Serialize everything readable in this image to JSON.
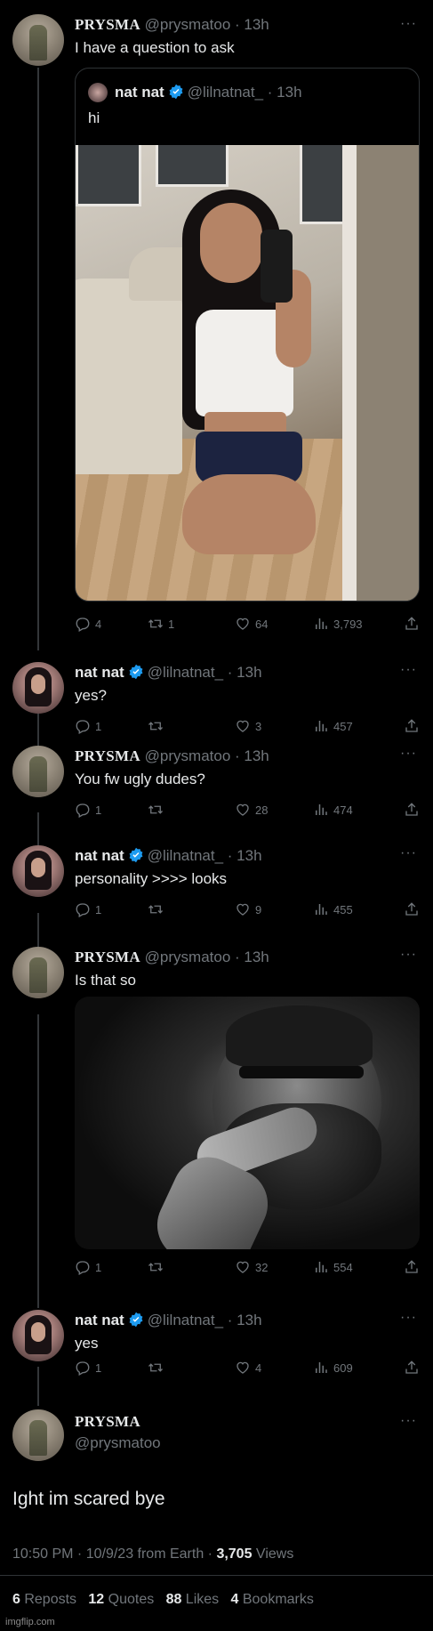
{
  "tweets": [
    {
      "name": "PRYSMA",
      "handle": "@prysmatoo",
      "time": "13h",
      "text": "I have a question to ask",
      "quote": {
        "name": "nat nat",
        "handle": "@lilnatnat_",
        "time": "13h",
        "text": "hi"
      },
      "replies": "4",
      "reposts": "1",
      "likes": "64",
      "views": "3,793"
    },
    {
      "name": "nat nat",
      "handle": "@lilnatnat_",
      "time": "13h",
      "text": "yes?",
      "replies": "1",
      "reposts": "",
      "likes": "3",
      "views": "457"
    },
    {
      "name": "PRYSMA",
      "handle": "@prysmatoo",
      "time": "13h",
      "text": "You fw ugly dudes?",
      "replies": "1",
      "reposts": "",
      "likes": "28",
      "views": "474"
    },
    {
      "name": "nat nat",
      "handle": "@lilnatnat_",
      "time": "13h",
      "text": "personality >>>> looks",
      "replies": "1",
      "reposts": "",
      "likes": "9",
      "views": "455"
    },
    {
      "name": "PRYSMA",
      "handle": "@prysmatoo",
      "time": "13h",
      "text": "Is that so",
      "replies": "1",
      "reposts": "",
      "likes": "32",
      "views": "554"
    },
    {
      "name": "nat nat",
      "handle": "@lilnatnat_",
      "time": "13h",
      "text": "yes",
      "replies": "1",
      "reposts": "",
      "likes": "4",
      "views": "609"
    }
  ],
  "main": {
    "name": "PRYSMA",
    "handle": "@prysmatoo",
    "text": "Ight im scared bye",
    "meta_time": "10:50 PM · 10/9/23 from Earth · ",
    "views_count": "3,705",
    "views_label": " Views",
    "reposts_count": "6",
    "reposts_label": " Reposts",
    "quotes_count": "12",
    "quotes_label": " Quotes",
    "likes_count": "88",
    "likes_label": " Likes",
    "bookmarks_count": "4",
    "bookmarks_label": " Bookmarks"
  },
  "more_icon": "···",
  "watermark": "imgflip.com",
  "colors": {
    "background": "#000000",
    "text": "#e7e9ea",
    "muted": "#71767b",
    "verified": "#1d9bf0"
  }
}
